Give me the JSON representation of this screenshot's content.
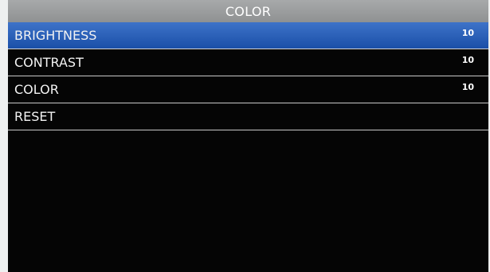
{
  "menu": {
    "title": "COLOR",
    "items": [
      {
        "label": "BRIGHTNESS",
        "value": "10",
        "selected": true
      },
      {
        "label": "CONTRAST",
        "value": "10",
        "selected": false
      },
      {
        "label": "COLOR",
        "value": "10",
        "selected": false
      },
      {
        "label": "RESET",
        "value": "",
        "selected": false
      }
    ]
  },
  "colors": {
    "selection": "#2a5fb8",
    "title_bar": "#9a9c9d",
    "background": "#050505"
  }
}
